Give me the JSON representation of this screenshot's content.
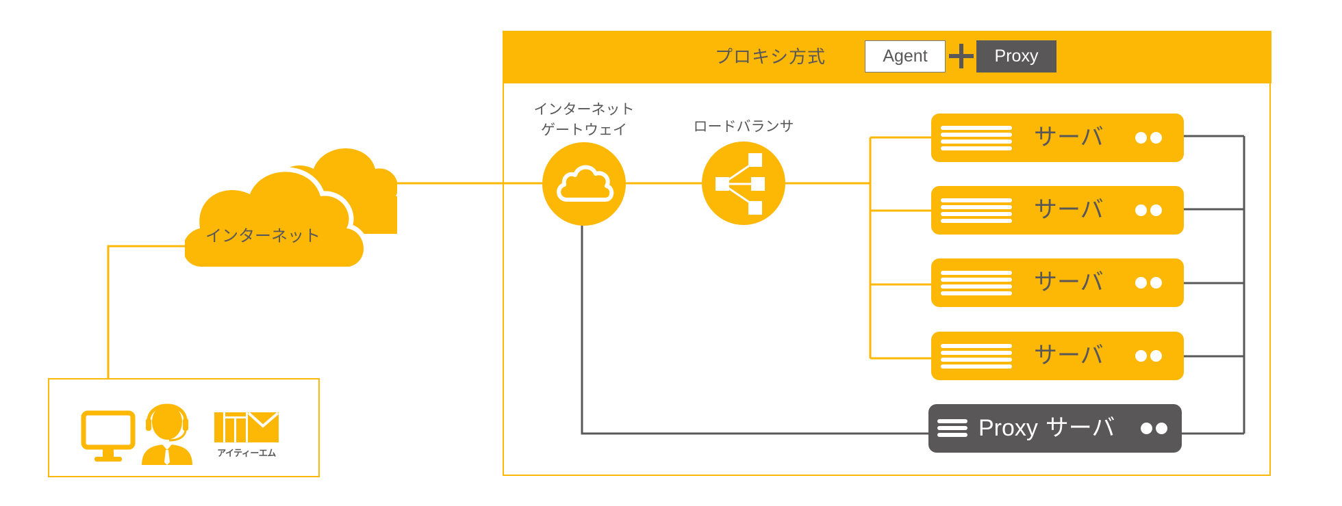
{
  "header": {
    "title": "プロキシ方式",
    "agent_label": "Agent",
    "plus_symbol": "+",
    "proxy_label": "Proxy"
  },
  "internet": {
    "label": "インターネット"
  },
  "gateway": {
    "label_line1": "インターネット",
    "label_line2": "ゲートウェイ",
    "icon": "cloud-icon"
  },
  "load_balancer": {
    "label": "ロードバランサ",
    "icon": "load-balancer-icon"
  },
  "servers": [
    {
      "label": "サーバ",
      "icon": "server-stripes-icon"
    },
    {
      "label": "サーバ",
      "icon": "server-stripes-icon"
    },
    {
      "label": "サーバ",
      "icon": "server-stripes-icon"
    },
    {
      "label": "サーバ",
      "icon": "server-stripes-icon"
    }
  ],
  "proxy_server": {
    "label_en": "Proxy",
    "label_jp": "サーバ",
    "icon": "server-stripes-icon"
  },
  "client": {
    "icons": [
      "monitor-icon",
      "operator-headset-icon",
      "itm-logo-icon"
    ],
    "logo_text": "アイティーエム"
  },
  "colors": {
    "accent": "#fdb705",
    "dark": "#595757",
    "white": "#ffffff"
  }
}
